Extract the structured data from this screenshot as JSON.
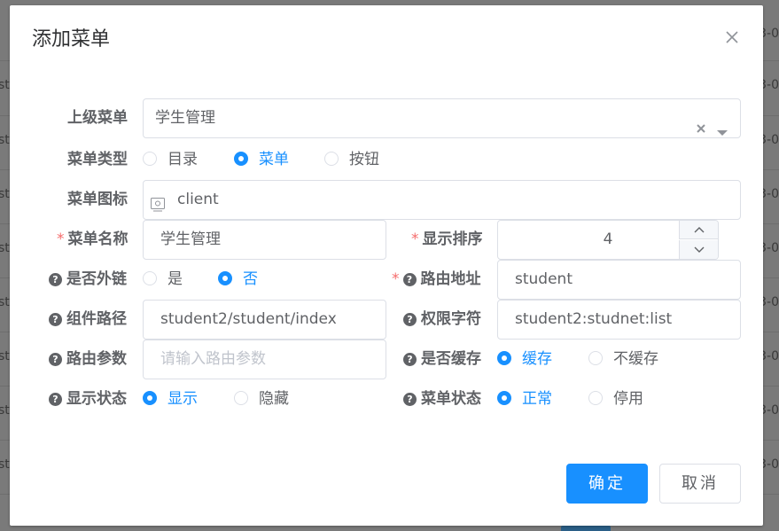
{
  "backdrop": {
    "left_fragments": [
      "st",
      "st",
      "st",
      "st",
      "st",
      "st",
      "st",
      "st"
    ],
    "right_fragments": [
      "3-0",
      "3-0",
      "3-0",
      "3-0",
      "3-0",
      "3-0",
      "3-0",
      "3-0",
      "3-0"
    ]
  },
  "dialog": {
    "title": "添加菜单",
    "confirm_label": "确定",
    "cancel_label": "取消"
  },
  "form": {
    "parent_menu": {
      "label": "上级菜单",
      "value": "学生管理"
    },
    "menu_type": {
      "label": "菜单类型",
      "options": [
        "目录",
        "菜单",
        "按钮"
      ],
      "selected": "菜单"
    },
    "menu_icon": {
      "label": "菜单图标",
      "value": "client"
    },
    "menu_name": {
      "label": "菜单名称",
      "required": "*",
      "value": "学生管理"
    },
    "order": {
      "label": "显示排序",
      "required": "*",
      "value": "4"
    },
    "is_external": {
      "label": "是否外链",
      "help": "?",
      "options": [
        "是",
        "否"
      ],
      "selected": "否"
    },
    "route_path": {
      "label": "路由地址",
      "required": "*",
      "help": "?",
      "value": "student"
    },
    "component_path": {
      "label": "组件路径",
      "help": "?",
      "value": "student2/student/index"
    },
    "permission": {
      "label": "权限字符",
      "help": "?",
      "value": "student2:studnet:list"
    },
    "route_params": {
      "label": "路由参数",
      "help": "?",
      "placeholder": "请输入路由参数",
      "value": ""
    },
    "cache": {
      "label": "是否缓存",
      "help": "?",
      "options": [
        "缓存",
        "不缓存"
      ],
      "selected": "缓存"
    },
    "visible": {
      "label": "显示状态",
      "help": "?",
      "options": [
        "显示",
        "隐藏"
      ],
      "selected": "显示"
    },
    "status": {
      "label": "菜单状态",
      "help": "?",
      "options": [
        "正常",
        "停用"
      ],
      "selected": "正常"
    }
  },
  "colors": {
    "primary": "#1890ff",
    "required": "#f56c6c",
    "text": "#606266"
  }
}
